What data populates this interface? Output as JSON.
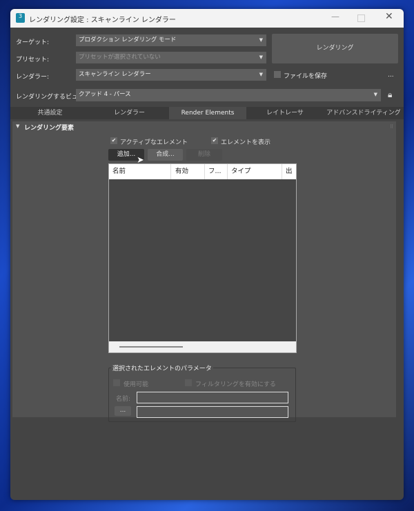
{
  "window": {
    "title": "レンダリング設定 : スキャンライン レンダラー",
    "app_icon": "3"
  },
  "controls": {
    "target_label": "ターゲット:",
    "target_value": "プロダクション レンダリング モード",
    "preset_label": "プリセット:",
    "preset_value": "プリセットが選択されていない",
    "renderer_label": "レンダラー:",
    "renderer_value": "スキャンライン レンダラー",
    "view_label": "レンダリングするビュー:",
    "view_value": "クアッド 4 - パース",
    "render_button": "レンダリング",
    "save_file_label": "ファイルを保存",
    "more_button": "..."
  },
  "tabs": [
    {
      "label": "共通設定"
    },
    {
      "label": "レンダラー"
    },
    {
      "label": "Render Elements"
    },
    {
      "label": "レイトレーサ"
    },
    {
      "label": "アドバンスドライティング"
    }
  ],
  "rollout": {
    "title": "レンダリング要素",
    "active_elements": "アクティブなエレメント",
    "show_elements": "エレメントを表示",
    "add_button": "追加...",
    "merge_button": "合成...",
    "delete_button": "削除",
    "columns": [
      "名前",
      "有効",
      "フ...",
      "タイプ",
      "出"
    ]
  },
  "params": {
    "title": "選択されたエレメントのパラメータ",
    "enabled": "使用可能",
    "filtering": "フィルタリングを有効にする",
    "name_label": "名前:",
    "browse_button": "...",
    "name_value": "",
    "path_value": ""
  }
}
